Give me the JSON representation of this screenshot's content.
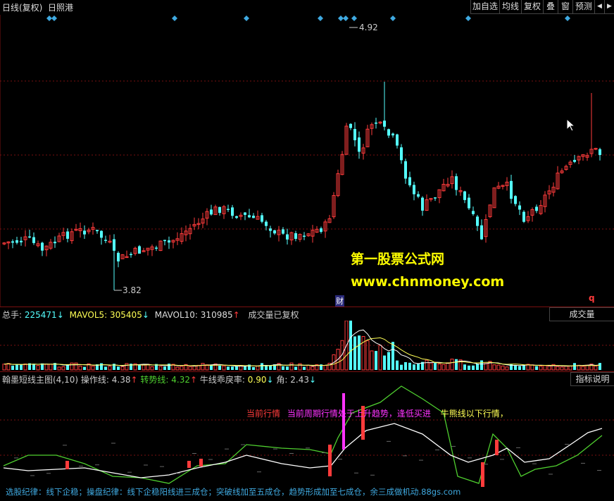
{
  "window": {
    "period_label": "日线(复权)",
    "stock_name": "日照港"
  },
  "toolbar": {
    "buttons": [
      "加自选",
      "均线",
      "复权",
      "叠",
      "窗",
      "预测"
    ],
    "prev_icon": "◀",
    "next_icon": "▶"
  },
  "main_chart": {
    "high_price": "4.92",
    "low_price": "3.82",
    "event_marker": "财",
    "q_marker": "q",
    "watermark_title": "第一股票公式网",
    "watermark_url": "www.chnmoney.com"
  },
  "volume_panel": {
    "total_label": "总手:",
    "total_value": "225471",
    "total_arrow": "↓",
    "mavol5_label": "MAVOL5:",
    "mavol5_value": "305405",
    "mavol5_arrow": "↓",
    "mavol10_label": "MAVOL10:",
    "mavol10_value": "310985",
    "mavol10_arrow": "↑",
    "note": "成交量已复权",
    "selector": "成交量"
  },
  "indicator_panel": {
    "name": "翰墨短线主图(4,10)",
    "op_label": "操作线:",
    "op_value": "4.38",
    "op_arrow": "↑",
    "turn_label": "转势线:",
    "turn_value": "4.32",
    "turn_arrow": "↑",
    "bull_label": "牛线乖戾率:",
    "bull_value": "0.90",
    "bull_arrow": "↓",
    "angle_label": "角:",
    "angle_value": "2.43",
    "angle_arrow": "↓",
    "help_button": "指标说明",
    "msg_red": "当前行情",
    "msg_magenta": "当前周期行情处于上升趋势，逢低买进",
    "msg_green": "牛熊线以下行情，",
    "footer": "选股纪律：线下企稳；操盘纪律：线下企稳阳线进三成仓；突破线加至五成仓，趋势形成加至七成仓，余三成做机动.88gs.com"
  },
  "colors": {
    "up": "#ff3b3b",
    "down": "#54ffff",
    "diamond": "#3fa9e0",
    "white_line": "#ffffff",
    "green_line": "#4fcf2f",
    "watermark": "#ffff00",
    "magenta": "#ff33ff",
    "grid": "#7a1010"
  }
}
